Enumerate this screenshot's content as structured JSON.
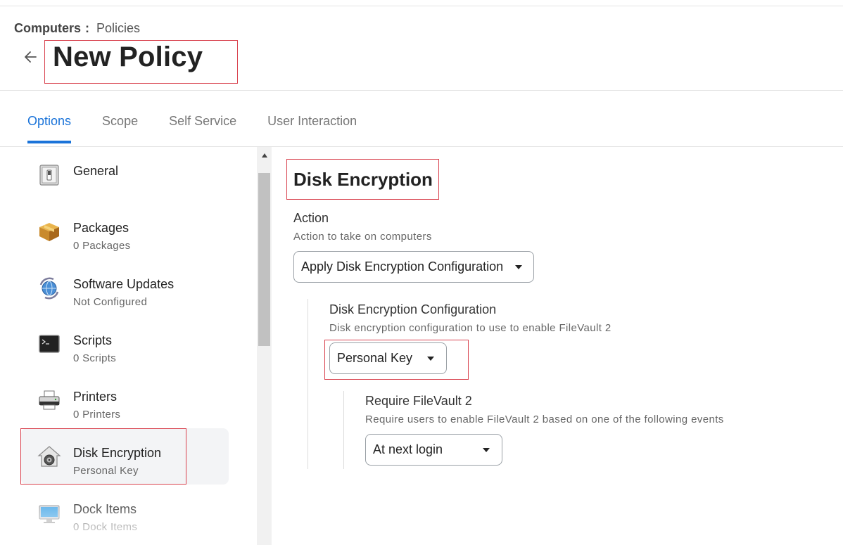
{
  "breadcrumb": {
    "root": "Computers",
    "separator": ":",
    "current": "Policies"
  },
  "page": {
    "title": "New Policy"
  },
  "tabs": [
    {
      "label": "Options",
      "active": true
    },
    {
      "label": "Scope",
      "active": false
    },
    {
      "label": "Self Service",
      "active": false
    },
    {
      "label": "User Interaction",
      "active": false
    }
  ],
  "sidebar": {
    "items": [
      {
        "label": "General",
        "sub": "",
        "icon": "switch-icon"
      },
      {
        "label": "Packages",
        "sub": "0 Packages",
        "icon": "package-box-icon"
      },
      {
        "label": "Software Updates",
        "sub": "Not Configured",
        "icon": "software-update-globe-icon"
      },
      {
        "label": "Scripts",
        "sub": "0 Scripts",
        "icon": "terminal-icon"
      },
      {
        "label": "Printers",
        "sub": "0 Printers",
        "icon": "printer-icon"
      },
      {
        "label": "Disk Encryption",
        "sub": "Personal Key",
        "icon": "filevault-house-icon",
        "selected": true
      },
      {
        "label": "Dock Items",
        "sub": "0 Dock Items",
        "icon": "monitor-icon"
      }
    ]
  },
  "main": {
    "section_title": "Disk Encryption",
    "action": {
      "label": "Action",
      "help": "Action to take on computers",
      "value": "Apply Disk Encryption Configuration"
    },
    "configuration": {
      "label": "Disk Encryption Configuration",
      "help": "Disk encryption configuration to use to enable FileVault 2",
      "value": "Personal Key"
    },
    "require": {
      "label": "Require FileVault 2",
      "help": "Require users to enable FileVault 2 based on one of the following events",
      "value": "At next login"
    }
  },
  "colors": {
    "accent": "#1a73d9",
    "highlight_box": "#d9434f"
  }
}
